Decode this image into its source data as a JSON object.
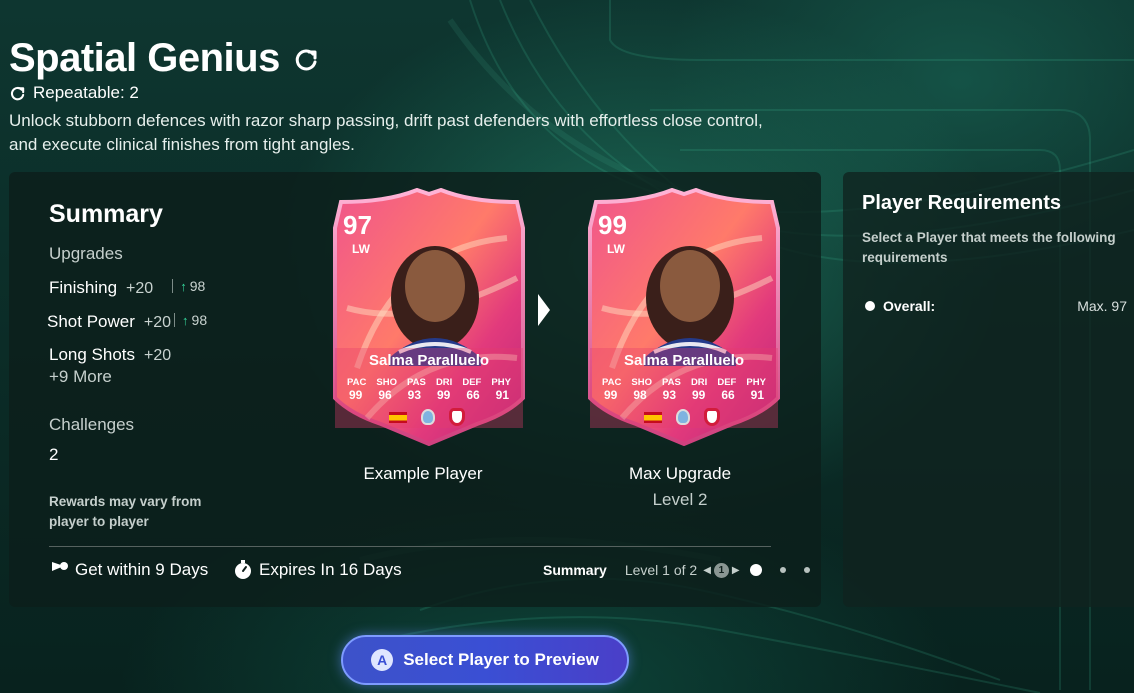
{
  "header": {
    "title": "Spatial Genius",
    "repeatable": "Repeatable: 2",
    "description": "Unlock stubborn defences with razor sharp passing, drift past defenders with effortless close control, and execute clinical finishes from tight angles."
  },
  "summary": {
    "title": "Summary",
    "upgrades_label": "Upgrades",
    "upgrades": [
      {
        "name": "Finishing",
        "plus": "+20",
        "target": "98"
      },
      {
        "name": "Shot Power",
        "plus": "+20",
        "target": "98"
      },
      {
        "name": "Long Shots",
        "plus": "+20",
        "target": ""
      }
    ],
    "more": "+9 More",
    "challenges_label": "Challenges",
    "challenges_value": "2",
    "rewards_note": "Rewards may vary from player to player"
  },
  "cards": {
    "example": {
      "rating": "97",
      "position": "LW",
      "name": "Salma Paralluelo",
      "stat_labels": [
        "PAC",
        "SHO",
        "PAS",
        "DRI",
        "DEF",
        "PHY"
      ],
      "stat_values": [
        "99",
        "96",
        "93",
        "99",
        "66",
        "91"
      ],
      "caption": "Example Player"
    },
    "max": {
      "rating": "99",
      "position": "LW",
      "name": "Salma Paralluelo",
      "stat_labels": [
        "PAC",
        "SHO",
        "PAS",
        "DRI",
        "DEF",
        "PHY"
      ],
      "stat_values": [
        "99",
        "98",
        "93",
        "99",
        "66",
        "91"
      ],
      "caption": "Max Upgrade",
      "sub": "Level 2"
    }
  },
  "footer": {
    "get_within": "Get within 9 Days",
    "expires": "Expires In 16 Days",
    "pager_summary": "Summary",
    "pager_level": "Level 1 of 2",
    "pager_button": "1"
  },
  "requirements": {
    "title": "Player Requirements",
    "description": "Select a Player that meets the following requirements",
    "items": [
      {
        "label": "Overall:",
        "value": "Max. 97"
      }
    ]
  },
  "cta": {
    "badge": "A",
    "label": "Select Player to Preview"
  },
  "colors": {
    "accent_green": "#35d49a",
    "cta_blue": "#3a4fd4",
    "card_pink": "#e8477a"
  }
}
